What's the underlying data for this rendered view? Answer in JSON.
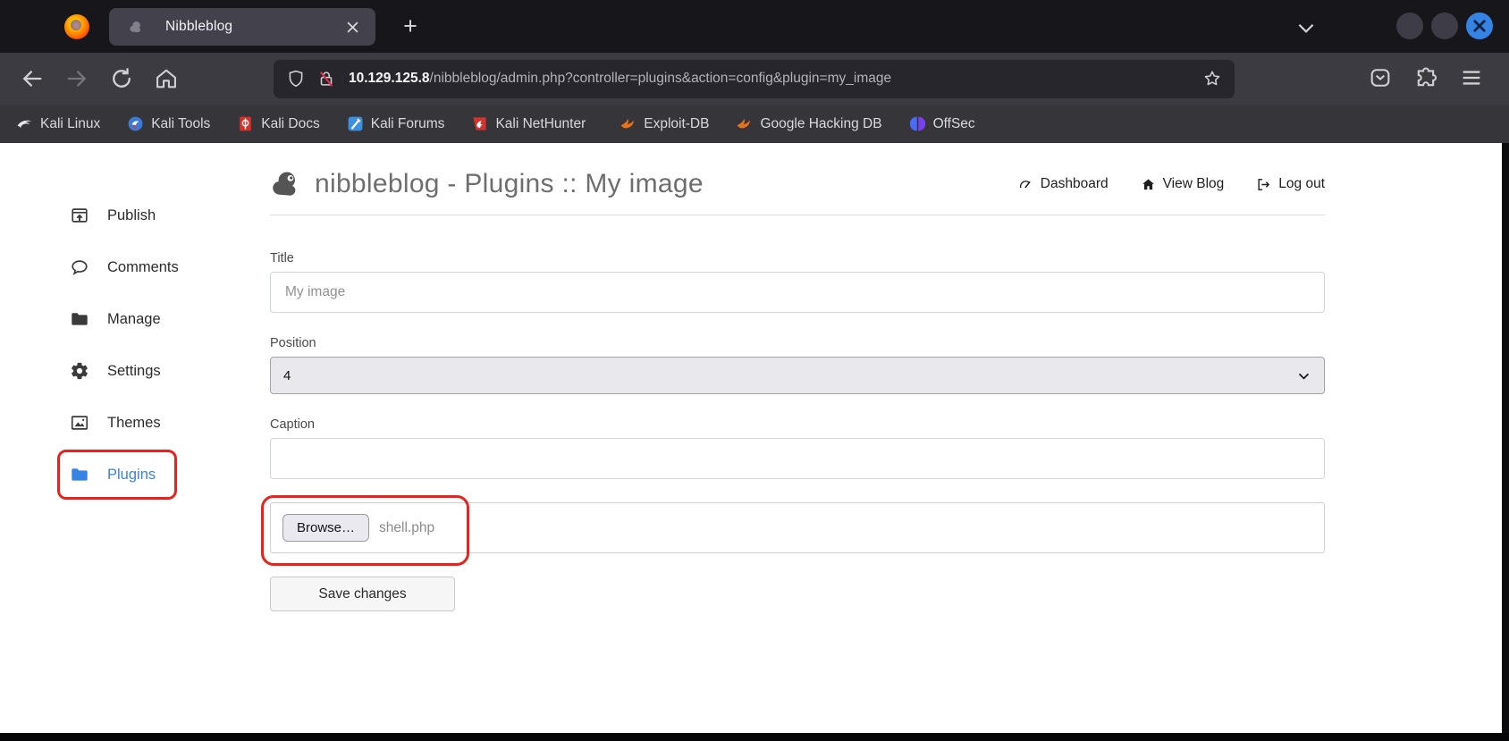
{
  "browser": {
    "tab": {
      "title": "Nibbleblog"
    },
    "new_tab_label": "+",
    "url": {
      "host": "10.129.125.8",
      "path": "/nibbleblog/admin.php?controller=plugins&action=config&plugin=my_image"
    },
    "bookmarks": [
      {
        "icon": "kali-linux-icon",
        "label": "Kali Linux"
      },
      {
        "icon": "kali-tools-icon",
        "label": "Kali Tools"
      },
      {
        "icon": "kali-docs-icon",
        "label": "Kali Docs"
      },
      {
        "icon": "kali-forums-icon",
        "label": "Kali Forums"
      },
      {
        "icon": "kali-nethunter-icon",
        "label": "Kali NetHunter"
      },
      {
        "icon": "exploit-db-icon",
        "label": "Exploit-DB"
      },
      {
        "icon": "ghdb-icon",
        "label": "Google Hacking DB"
      },
      {
        "icon": "offsec-icon",
        "label": "OffSec"
      }
    ]
  },
  "page": {
    "header": {
      "title": "nibbleblog - Plugins :: My image"
    },
    "nav": [
      {
        "label": "Dashboard"
      },
      {
        "label": "View Blog"
      },
      {
        "label": "Log out"
      }
    ],
    "sidebar": [
      {
        "label": "Publish"
      },
      {
        "label": "Comments"
      },
      {
        "label": "Manage"
      },
      {
        "label": "Settings"
      },
      {
        "label": "Themes"
      },
      {
        "label": "Plugins",
        "active": true
      }
    ],
    "form": {
      "title_label": "Title",
      "title_placeholder": "My image",
      "position_label": "Position",
      "position_value": "4",
      "caption_label": "Caption",
      "browse_label": "Browse…",
      "file_name": "shell.php",
      "save_label": "Save changes"
    }
  },
  "colors": {
    "accent_blue": "#3584e4",
    "annotation_red": "#e8231d"
  }
}
